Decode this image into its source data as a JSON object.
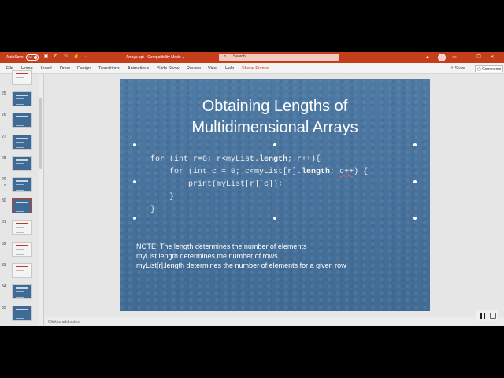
{
  "titlebar": {
    "autosave_label": "AutoSave",
    "autosave_state": "Off",
    "document_title": "Arrays.ppt - Compatibility Mode",
    "search_placeholder": "Search",
    "icons": [
      "save-icon",
      "undo-icon",
      "redo-icon",
      "touch-mode-icon",
      "customize-icon",
      "warning-icon",
      "user-avatar",
      "ribbon-display-icon",
      "minimize-icon",
      "maximize-icon",
      "close-icon"
    ],
    "accent_color": "#c43e1c"
  },
  "ribbon": {
    "tabs": [
      "File",
      "Home",
      "Insert",
      "Draw",
      "Design",
      "Transitions",
      "Animations",
      "Slide Show",
      "Review",
      "View",
      "Help",
      "Shape Format"
    ],
    "active_tab": "Shape Format",
    "share_label": "Share",
    "comments_label": "Comments"
  },
  "thumbnails": {
    "items": [
      {
        "number": "",
        "starred": false,
        "light": true
      },
      {
        "number": "25",
        "starred": false,
        "light": false
      },
      {
        "number": "26",
        "starred": false,
        "light": false
      },
      {
        "number": "27",
        "starred": false,
        "light": false
      },
      {
        "number": "28",
        "starred": false,
        "light": false
      },
      {
        "number": "29",
        "starred": true,
        "light": false
      },
      {
        "number": "30",
        "starred": false,
        "light": false,
        "selected": true
      },
      {
        "number": "31",
        "starred": false,
        "light": true
      },
      {
        "number": "32",
        "starred": false,
        "light": true
      },
      {
        "number": "33",
        "starred": false,
        "light": true
      },
      {
        "number": "34",
        "starred": false,
        "light": false
      },
      {
        "number": "35",
        "starred": false,
        "light": false
      }
    ],
    "star_glyph": "*"
  },
  "slide": {
    "title_line1": "Obtaining Lengths of",
    "title_line2": "Multidimensional Arrays",
    "code": {
      "line1_pre": "for (int r=0; r<myList.",
      "line1_kw": "length",
      "line1_post": "; r++){",
      "line2_pre": "    for (int c = 0; c<myList[r].",
      "line2_kw": "length",
      "line2_mid": "; ",
      "line2_ul": "c++",
      "line2_post": ") {",
      "line3": "        print(myList[r][c]);",
      "line4": "    }",
      "line5": "}"
    },
    "notes": [
      "NOTE: The length determines the number of elements",
      "myList.length determines the number of rows",
      "myList[r].length determines the number of elements for a given row"
    ],
    "background_color": "#4a74a0"
  },
  "notes_pane": {
    "placeholder": "Click to add notes"
  }
}
